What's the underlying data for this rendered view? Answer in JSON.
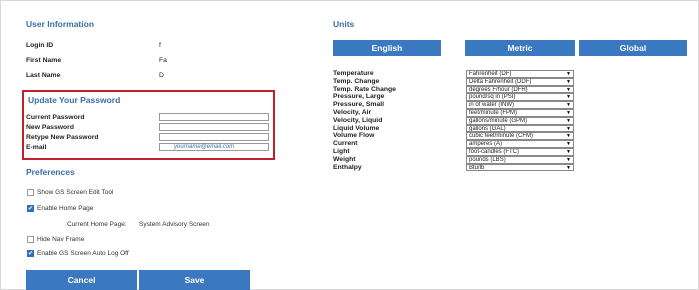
{
  "user_info": {
    "title": "User Information",
    "rows": [
      {
        "label": "Login ID",
        "value": "f"
      },
      {
        "label": "First Name",
        "value": "Fa"
      },
      {
        "label": "Last Name",
        "value": "D"
      }
    ]
  },
  "password": {
    "title": "Update Your Password",
    "current_label": "Current Password",
    "new_label": "New Password",
    "retype_label": "Retype New Password",
    "email_label": "E-mail",
    "email_value": "yourname@email.com"
  },
  "preferences": {
    "title": "Preferences",
    "show_gs_edit": {
      "label": "Show GS Screen Edit Tool",
      "checked": false
    },
    "enable_home": {
      "label": "Enable Home Page",
      "checked": true
    },
    "current_home_label": "Current Home Page:",
    "current_home_value": "System Advisory Screen",
    "hide_nav": {
      "label": "Hide Nav Frame",
      "checked": false
    },
    "auto_logoff": {
      "label": "Enable GS Screen Auto Log Off",
      "checked": true
    }
  },
  "buttons": {
    "cancel": "Cancel",
    "save": "Save"
  },
  "units": {
    "title": "Units",
    "systems": [
      "English",
      "Metric",
      "Global"
    ],
    "rows": [
      {
        "label": "Temperature",
        "value": "Fahrenheit (DF)"
      },
      {
        "label": "Temp. Change",
        "value": "Delta Fahrenheit (DDF)"
      },
      {
        "label": "Temp. Rate Change",
        "value": "degrees F/hour (DFH)"
      },
      {
        "label": "Pressure, Large",
        "value": "pound/sq in (PSI)"
      },
      {
        "label": "Pressure, Small",
        "value": "in of water (INW)"
      },
      {
        "label": "Velocity, Air",
        "value": "feet/minute (FPM)"
      },
      {
        "label": "Velocity, Liquid",
        "value": "gallons/minute (GPM)"
      },
      {
        "label": "Liquid Volume",
        "value": "gallons (GAL)"
      },
      {
        "label": "Volume Flow",
        "value": "cubic feet/minute (CFM)"
      },
      {
        "label": "Current",
        "value": "amperes (A)"
      },
      {
        "label": "Light",
        "value": "foot-candles (FTC)"
      },
      {
        "label": "Weight",
        "value": "pounds (LBS)"
      },
      {
        "label": "Enthalpy",
        "value": "Btu/lb"
      }
    ]
  }
}
